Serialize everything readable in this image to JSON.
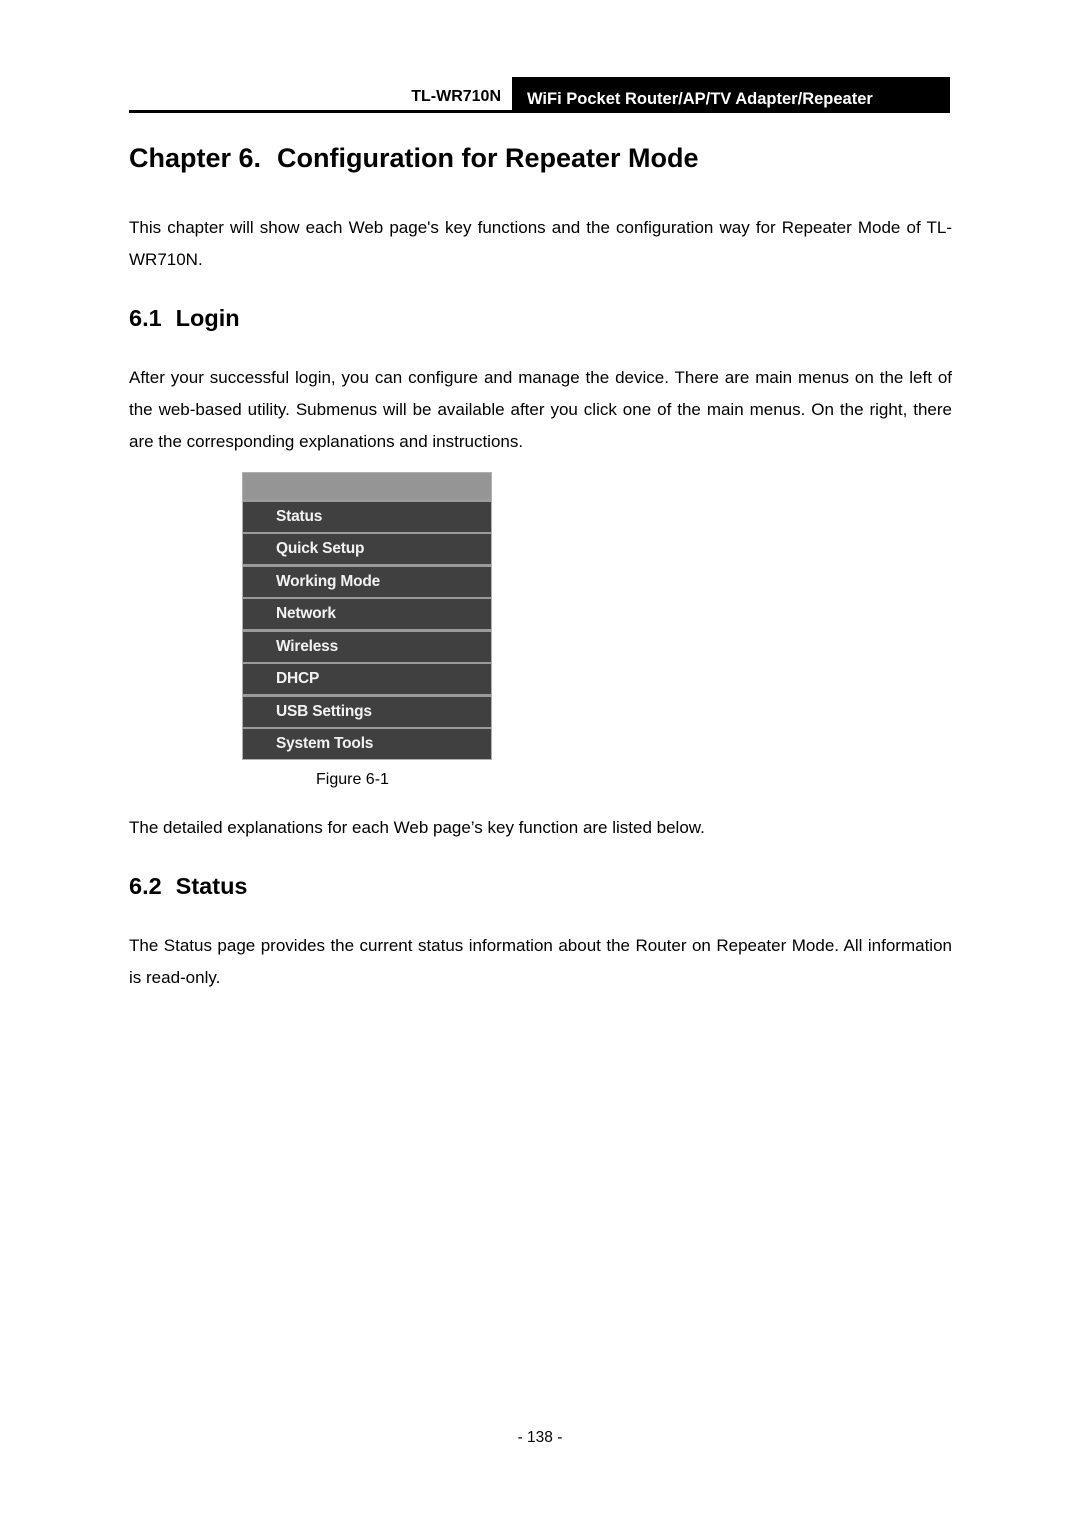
{
  "header": {
    "model": "TL-WR710N",
    "product": "WiFi Pocket Router/AP/TV Adapter/Repeater"
  },
  "chapter": {
    "number": "Chapter 6.",
    "title": "Configuration for Repeater Mode",
    "intro": "This chapter will show each Web page's key functions and the configuration way for Repeater Mode of TL-WR710N."
  },
  "sections": [
    {
      "number": "6.1",
      "title": "Login",
      "body": "After your successful login, you can configure and manage the device. There are main menus on the left of the web-based utility. Submenus will be available after you click one of the main menus. On the right, there are the corresponding explanations and instructions.",
      "after_figure": "The detailed explanations for each Web page’s key function are listed below."
    },
    {
      "number": "6.2",
      "title": "Status",
      "body": "The Status page provides the current status information about the Router on Repeater Mode. All information is read-only."
    }
  ],
  "figure": {
    "caption": "Figure 6-1",
    "menu_items": [
      "Status",
      "Quick Setup",
      "Working Mode",
      "Network",
      "Wireless",
      "DHCP",
      "USB Settings",
      "System Tools"
    ]
  },
  "footer": {
    "page_number": "- 138 -"
  }
}
